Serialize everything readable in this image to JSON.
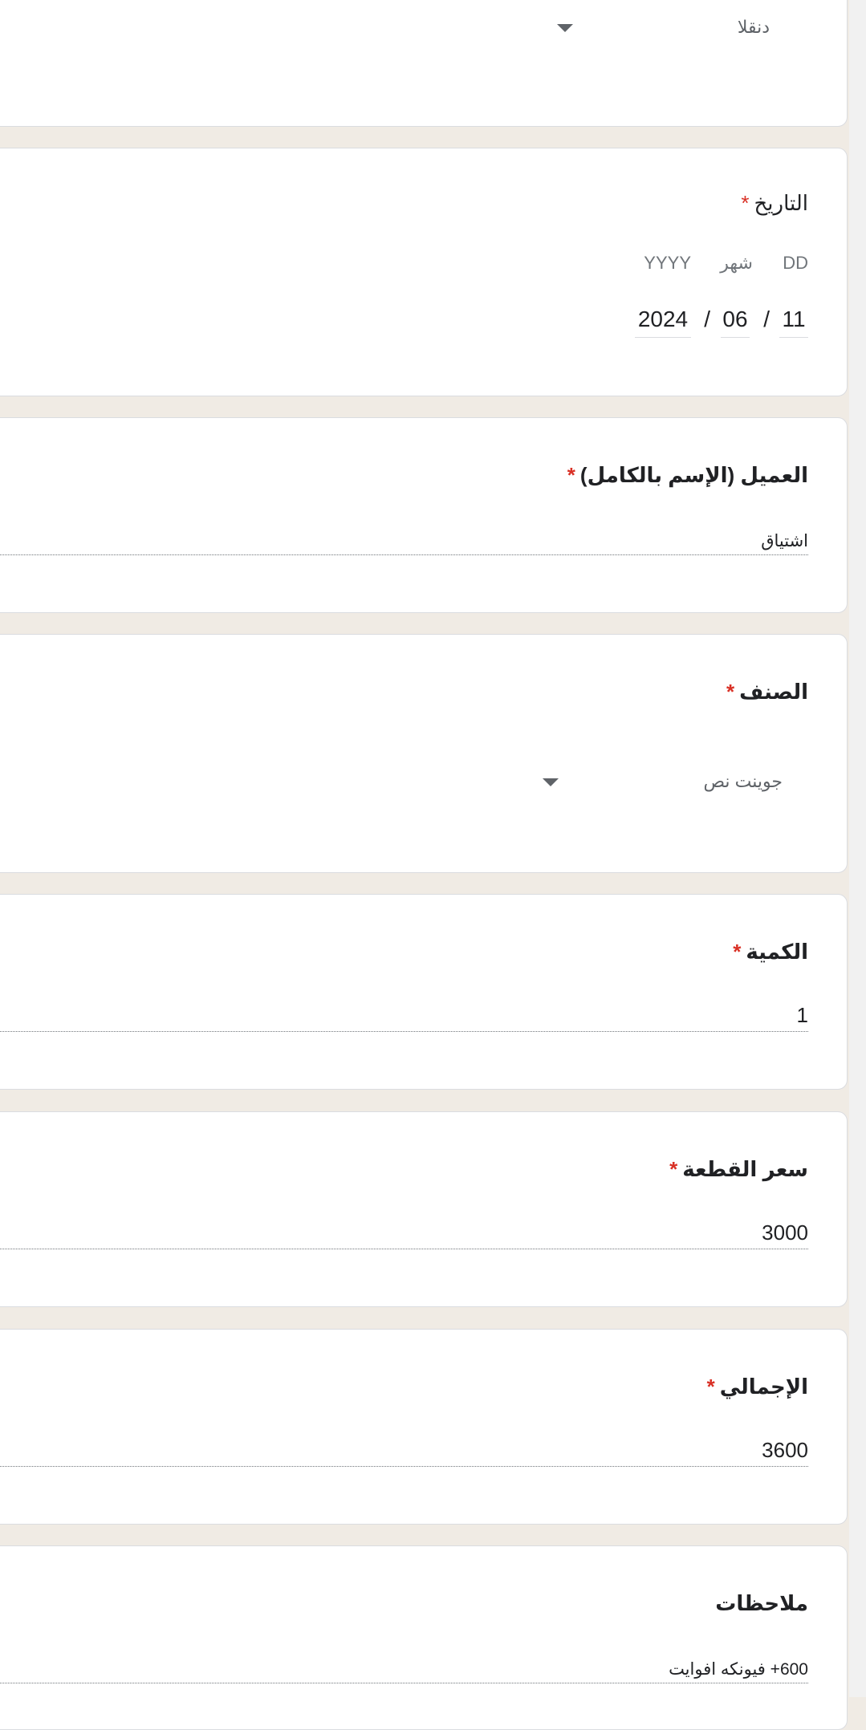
{
  "questions": {
    "location": {
      "value": "دنقلا"
    },
    "date": {
      "label": "التاريخ",
      "required_mark": "*",
      "day_label": "DD",
      "month_label": "شهر",
      "year_label": "YYYY",
      "day": "11",
      "month": "06",
      "year": "2024",
      "separator": "/"
    },
    "customer": {
      "label": "العميل (الإسم بالكامل)",
      "required_mark": "*",
      "value": "اشتياق"
    },
    "item": {
      "label": "الصنف",
      "required_mark": "*",
      "value": "جوينت نص"
    },
    "quantity": {
      "label": "الكمية",
      "required_mark": "*",
      "value": "1"
    },
    "unit_price": {
      "label": "سعر القطعة",
      "required_mark": "*",
      "value": "3000"
    },
    "total": {
      "label": "الإجمالي",
      "required_mark": "*",
      "value": "3600"
    },
    "notes": {
      "label": "ملاحظات",
      "value": "600+ فيونكه افوايت"
    }
  },
  "icons": {
    "dropdown": "chevron-down-icon"
  },
  "colors": {
    "page_background": "#f0ebe4",
    "card_background": "#ffffff",
    "required": "#d93025",
    "text": "#202124",
    "secondary_text": "#5f6368"
  }
}
